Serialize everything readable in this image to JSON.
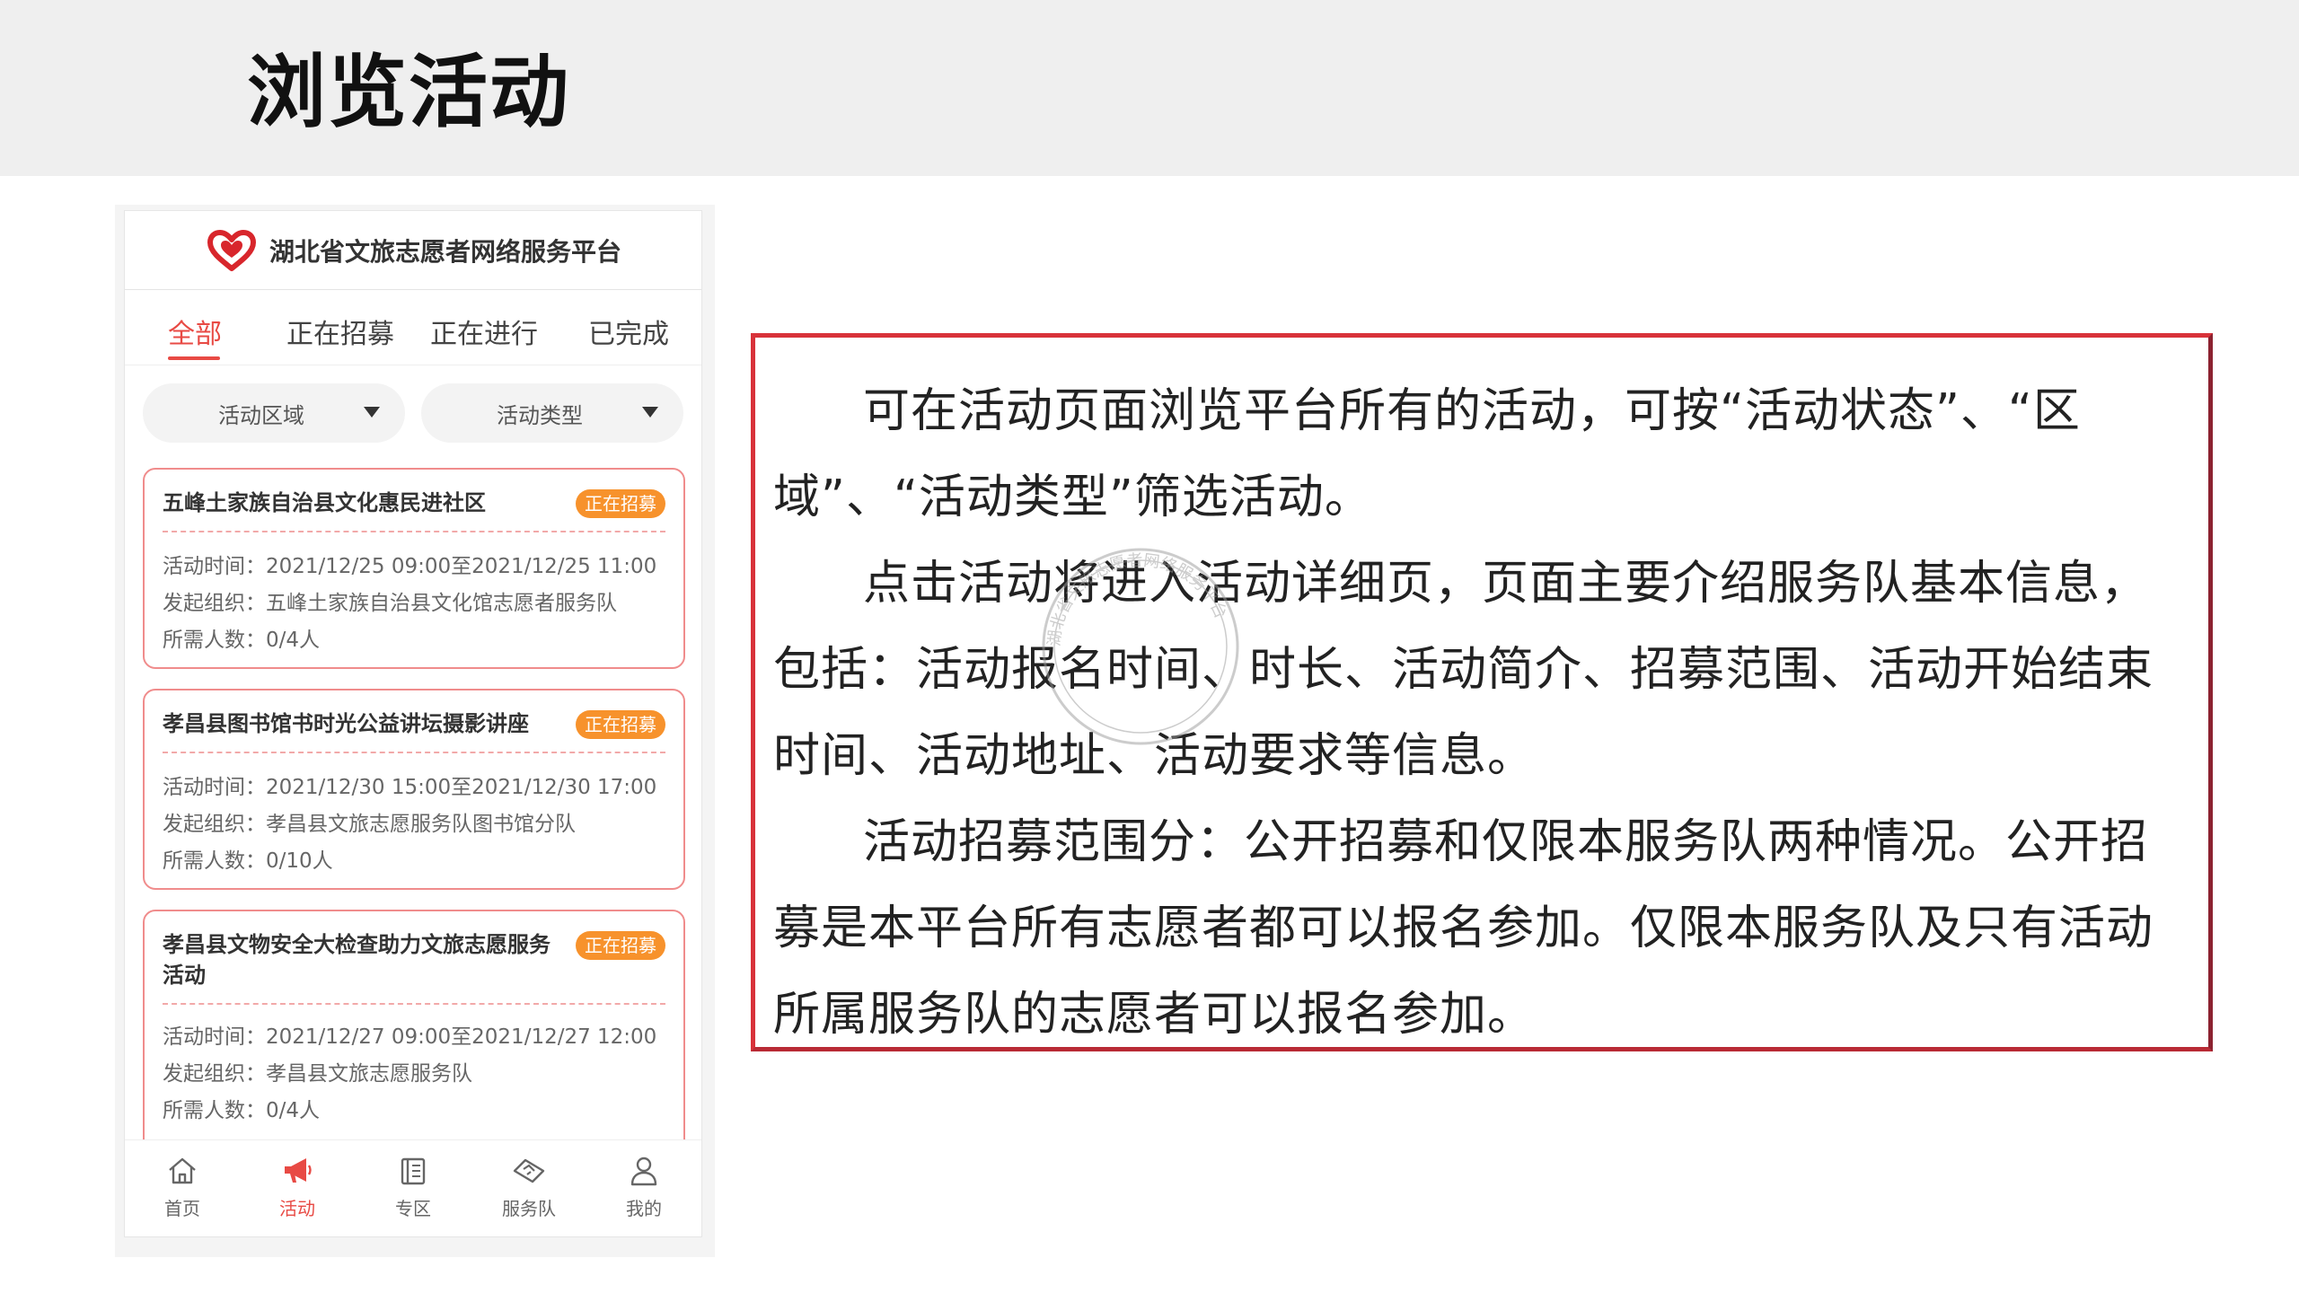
{
  "slide": {
    "title": "浏览活动"
  },
  "app": {
    "name": "湖北省文旅志愿者网络服务平台"
  },
  "tabs": [
    {
      "label": "全部",
      "active": true
    },
    {
      "label": "正在招募",
      "active": false
    },
    {
      "label": "正在进行",
      "active": false
    },
    {
      "label": "已完成",
      "active": false
    }
  ],
  "filters": {
    "area": "活动区域",
    "type": "活动类型"
  },
  "labels": {
    "time": "活动时间：",
    "org": "发起组织：",
    "people": "所需人数："
  },
  "activities": [
    {
      "title": "五峰土家族自治县文化惠民进社区",
      "badge": "正在招募",
      "time": "2021/12/25 09:00至2021/12/25 11:00",
      "org": "五峰土家族自治县文化馆志愿者服务队",
      "people": "0/4人"
    },
    {
      "title": "孝昌县图书馆书时光公益讲坛摄影讲座",
      "badge": "正在招募",
      "time": "2021/12/30 15:00至2021/12/30 17:00",
      "org": "孝昌县文旅志愿服务队图书馆分队",
      "people": "0/10人"
    },
    {
      "title": "孝昌县文物安全大检查助力文旅志愿服务活动",
      "badge": "正在招募",
      "time": "2021/12/27 09:00至2021/12/27 12:00",
      "org": "孝昌县文旅志愿服务队",
      "people": "0/4人"
    }
  ],
  "nav": [
    {
      "label": "首页",
      "icon": "home-icon",
      "active": false
    },
    {
      "label": "活动",
      "icon": "megaphone-icon",
      "active": true
    },
    {
      "label": "专区",
      "icon": "book-icon",
      "active": false
    },
    {
      "label": "服务队",
      "icon": "handshake-icon",
      "active": false
    },
    {
      "label": "我的",
      "icon": "user-icon",
      "active": false
    }
  ],
  "description": [
    "可在活动页面浏览平台所有的活动，可按“活动状态”、“区域”、“活动类型”筛选活动。",
    "点击活动将进入活动详细页，页面主要介绍服务队基本信息，包括：活动报名时间、时长、活动简介、招募范围、活动开始结束时间、活动地址、活动要求等信息。",
    "活动招募范围分：公开招募和仅限本服务队两种情况。公开招募是本平台所有志愿者都可以报名参加。仅限本服务队及只有活动所属服务队的志愿者可以报名参加。"
  ],
  "watermark": "湖北省文旅志愿者网络服务平台",
  "colors": {
    "accent": "#e84a44",
    "badge": "#f7922c",
    "border": "#d8323a"
  }
}
